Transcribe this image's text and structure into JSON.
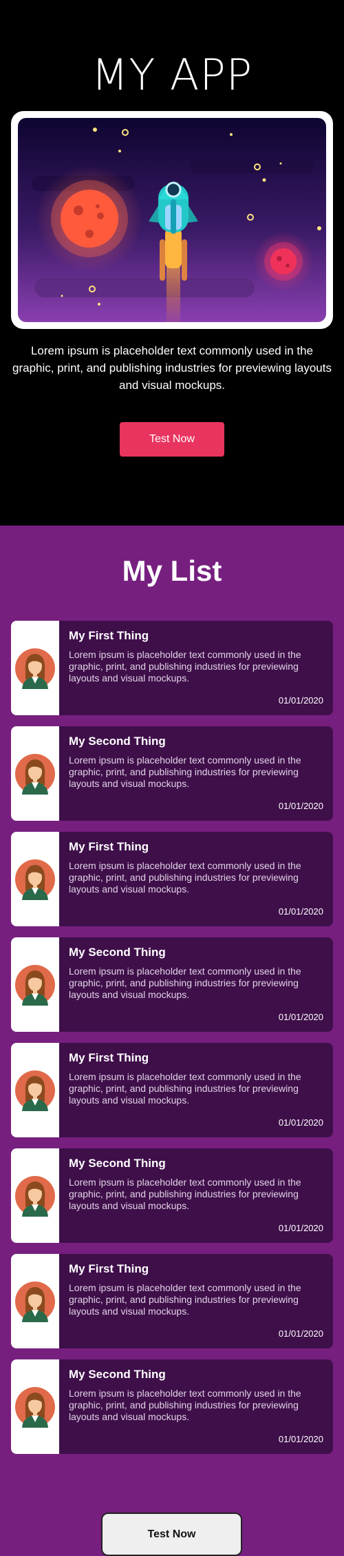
{
  "hero": {
    "app_title": "MY APP",
    "illustration_icon": "rocket-illustration",
    "description": "Lorem ipsum is placeholder text commonly used in the graphic, print, and publishing industries for previewing layouts and visual mockups.",
    "button_label": "Test Now",
    "button_color": "#e8345f"
  },
  "list": {
    "title": "My List",
    "avatar_icon": "woman-avatar-icon",
    "items": [
      {
        "title": "My First Thing",
        "description": "Lorem ipsum is placeholder text commonly used in the graphic, print, and publishing industries for previewing layouts and visual mockups.",
        "date": "01/01/2020"
      },
      {
        "title": "My Second Thing",
        "description": "Lorem ipsum is placeholder text commonly used in the graphic, print, and publishing industries for previewing layouts and visual mockups.",
        "date": "01/01/2020"
      },
      {
        "title": "My First Thing",
        "description": "Lorem ipsum is placeholder text commonly used in the graphic, print, and publishing industries for previewing layouts and visual mockups.",
        "date": "01/01/2020"
      },
      {
        "title": "My Second Thing",
        "description": "Lorem ipsum is placeholder text commonly used in the graphic, print, and publishing industries for previewing layouts and visual mockups.",
        "date": "01/01/2020"
      },
      {
        "title": "My First Thing",
        "description": "Lorem ipsum is placeholder text commonly used in the graphic, print, and publishing industries for previewing layouts and visual mockups.",
        "date": "01/01/2020"
      },
      {
        "title": "My Second Thing",
        "description": "Lorem ipsum is placeholder text commonly used in the graphic, print, and publishing industries for previewing layouts and visual mockups.",
        "date": "01/01/2020"
      },
      {
        "title": "My First Thing",
        "description": "Lorem ipsum is placeholder text commonly used in the graphic, print, and publishing industries for previewing layouts and visual mockups.",
        "date": "01/01/2020"
      },
      {
        "title": "My Second Thing",
        "description": "Lorem ipsum is placeholder text commonly used in the graphic, print, and publishing industries for previewing layouts and visual mockups.",
        "date": "01/01/2020"
      }
    ],
    "bottom_button_label": "Test Now"
  },
  "colors": {
    "hero_background": "#000000",
    "list_background": "#761f7f",
    "card_background": "#3f0f4a"
  }
}
